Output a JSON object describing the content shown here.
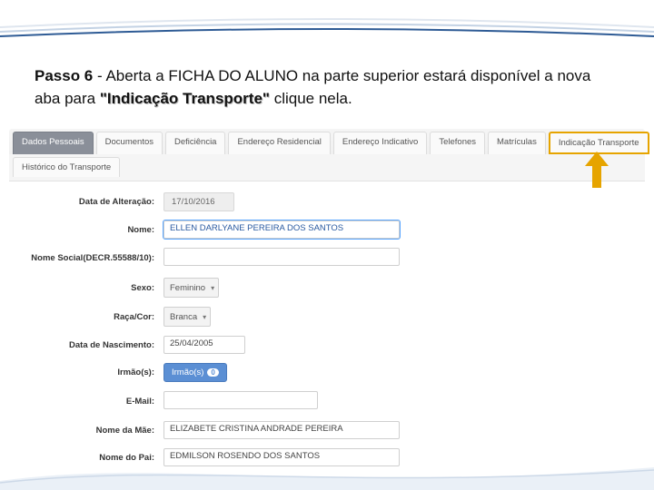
{
  "instruction": {
    "step_label": "Passo 6",
    "sep": " -  ",
    "part1": "Aberta a FICHA DO ALUNO na parte superior estará disponível a nova aba para ",
    "bold_tab": "\"Indicação Transporte\"",
    "part2": " clique nela."
  },
  "tabs_row1": [
    {
      "label": "Dados Pessoais",
      "active": true
    },
    {
      "label": "Documentos"
    },
    {
      "label": "Deficiência"
    },
    {
      "label": "Endereço Residencial"
    },
    {
      "label": "Endereço Indicativo"
    },
    {
      "label": "Telefones"
    },
    {
      "label": "Matrículas"
    },
    {
      "label": "Indicação Transporte",
      "highlight": true
    }
  ],
  "tabs_row2": [
    {
      "label": "Histórico do Transporte"
    }
  ],
  "form": {
    "data_alteracao": {
      "label": "Data de Alteração:",
      "value": "17/10/2016"
    },
    "nome": {
      "label": "Nome:",
      "value": "ELLEN DARLYANE PEREIRA DOS SANTOS"
    },
    "nome_social": {
      "label": "Nome Social(DECR.55588/10):",
      "value": ""
    },
    "sexo": {
      "label": "Sexo:",
      "value": "Feminino"
    },
    "raca_cor": {
      "label": "Raça/Cor:",
      "value": "Branca"
    },
    "data_nascimento": {
      "label": "Data de Nascimento:",
      "value": "25/04/2005"
    },
    "irmaos": {
      "label": "Irmão(s):",
      "button": "Irmão(s)",
      "count": "0"
    },
    "email": {
      "label": "E-Mail:",
      "value": ""
    },
    "nome_mae": {
      "label": "Nome da Mãe:",
      "value": "ELIZABETE CRISTINA ANDRADE PEREIRA"
    },
    "nome_pai": {
      "label": "Nome do Pai:",
      "value": "EDMILSON ROSENDO DOS SANTOS"
    }
  }
}
